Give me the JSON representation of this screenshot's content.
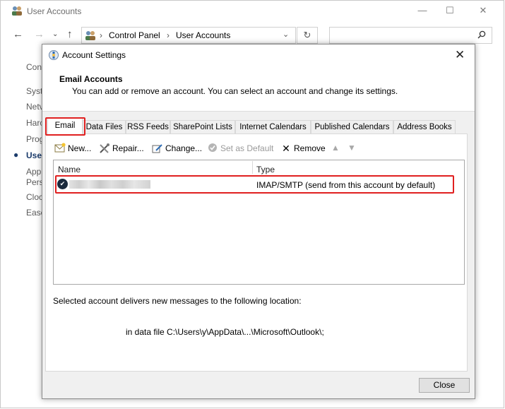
{
  "control_panel": {
    "title": "User Accounts",
    "breadcrumb": [
      "Control Panel",
      "User Accounts"
    ],
    "sidebar_items": [
      "Con",
      "Syst",
      "Netv",
      "Harc",
      "Prog",
      "Use",
      "App",
      "Pers",
      "Cloc",
      "Ease"
    ],
    "active_sidebar_item": "Use",
    "window_buttons": {
      "minimize": "—",
      "maximize": "☐",
      "close": "✕"
    }
  },
  "dialog": {
    "title": "Account Settings",
    "header_title": "Email Accounts",
    "header_description": "You can add or remove an account. You can select an account and change its settings.",
    "tabs": [
      "Email",
      "Data Files",
      "RSS Feeds",
      "SharePoint Lists",
      "Internet Calendars",
      "Published Calendars",
      "Address Books"
    ],
    "active_tab": "Email",
    "toolbar": {
      "new": "New...",
      "repair": "Repair...",
      "change": "Change...",
      "set_default": "Set as Default",
      "remove": "Remove"
    },
    "list": {
      "columns": [
        "Name",
        "Type"
      ],
      "rows": [
        {
          "name": "",
          "type": "IMAP/SMTP (send from this account by default)"
        }
      ]
    },
    "deliver_label": "Selected account delivers new messages to the following location:",
    "deliver_path": "in data file C:\\Users\\y\\AppData\\...\\Microsoft\\Outlook\\;",
    "close_button": "Close"
  },
  "colors": {
    "highlight_box": "#e02020",
    "dialog_bg": "#f0f0f0"
  }
}
